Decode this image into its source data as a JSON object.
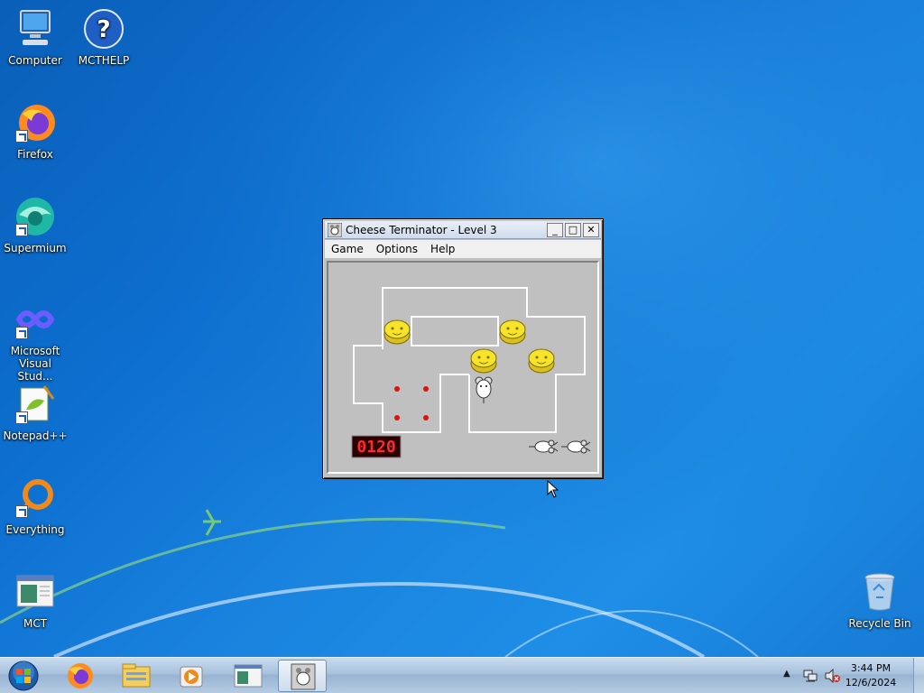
{
  "desktop": {
    "icons": [
      {
        "label": "Computer",
        "icon": "computer-icon"
      },
      {
        "label": "MCTHELP",
        "icon": "help-icon"
      },
      {
        "label": "Firefox",
        "icon": "firefox-icon"
      },
      {
        "label": "Supermium",
        "icon": "supermium-icon"
      },
      {
        "label": "Microsoft Visual Stud...",
        "icon": "visual-studio-icon"
      },
      {
        "label": "Notepad++",
        "icon": "notepadpp-icon"
      },
      {
        "label": "Everything",
        "icon": "everything-icon"
      },
      {
        "label": "MCT",
        "icon": "mct-icon"
      },
      {
        "label": "Recycle Bin",
        "icon": "recycle-bin-icon"
      }
    ]
  },
  "window": {
    "title": "Cheese Terminator - Level 3",
    "menu": [
      "Game",
      "Options",
      "Help"
    ],
    "controls": {
      "minimize": "_",
      "maximize": "□",
      "close": "✕"
    }
  },
  "game": {
    "level": 3,
    "score_display": "0120",
    "lives_remaining": 2,
    "cheese_count": 4,
    "pellet_count": 4,
    "colors": {
      "score_bg": "#2a0000",
      "score_digits": "#ff2a2a",
      "cheese": "#f5e42a",
      "pellet": "#e01010",
      "wall": "#ffffff"
    }
  },
  "taskbar": {
    "items": [
      "start-orb-icon",
      "firefox-icon",
      "explorer-icon",
      "media-player-icon",
      "mct-icon",
      "cheese-terminator-icon"
    ],
    "clock": {
      "time": "3:44 PM",
      "date": "12/6/2024"
    }
  }
}
